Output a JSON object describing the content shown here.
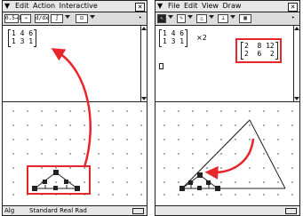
{
  "left": {
    "menu": {
      "icon": "menu-icon",
      "items": [
        "Edit",
        "Action",
        "Interactive"
      ]
    },
    "toolbar": {
      "btn1": "0.5→1/2",
      "btn2": "⇒",
      "btn3": "d/dx",
      "btn4": "∫",
      "btn5": "⊡"
    },
    "matrix": {
      "row1": "1 4 6",
      "row2": "1 3 1"
    },
    "status": {
      "mode": "Alg",
      "settings": "Standard Real Rad"
    }
  },
  "right": {
    "menu": {
      "icon": "menu-icon",
      "items": [
        "File",
        "Edit",
        "View",
        "Draw"
      ]
    },
    "matrix": {
      "row1": "1 4 6",
      "row2": "1 3 1",
      "operation": "×2"
    },
    "result": {
      "row1": "2  8 12",
      "row2": "2  6  2"
    }
  },
  "colors": {
    "accent": "#e8252b",
    "screen": "#f4f4f4",
    "ink": "#222222"
  }
}
